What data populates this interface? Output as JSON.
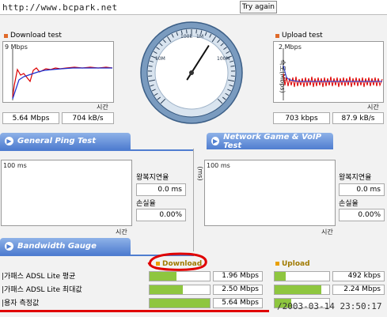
{
  "browser": {
    "url_text": "http://www.bcpark.net",
    "try_again_label": "Try again"
  },
  "download_test": {
    "title": "Download test",
    "max_label": "9 Mbps",
    "time_label": "시간",
    "speed_mbps": "5.64 Mbps",
    "speed_kbs": "704 kB/s"
  },
  "upload_test": {
    "title": "Upload test",
    "max_label": "2 Mbps",
    "y_axis_label": "속도(Mbps)",
    "time_label": "시간",
    "speed_kbps": "703 kbps",
    "speed_kbs": "87.9 kB/s"
  },
  "gauge": {
    "ticks": [
      "100k",
      "1M",
      "10M",
      "100M"
    ],
    "needle_level": 0.62
  },
  "general_ping": {
    "tab_label": "General Ping Test",
    "max_label": "100 ms",
    "time_label": "시간",
    "rtt_label": "왕복지연율",
    "rtt_value": "0.0 ms",
    "loss_label": "손실율",
    "loss_value": "0.00%"
  },
  "network_game": {
    "tab_label": "Network Game & VoIP Test",
    "max_label": "100 ms",
    "y_axis_label": "(ms)",
    "time_label": "시간",
    "rtt_label": "왕복지연율",
    "rtt_value": "0.0 ms",
    "loss_label": "손실율",
    "loss_value": "0.00%"
  },
  "bandwidth": {
    "tab_label": "Bandwidth Gauge",
    "download_header": "Download",
    "upload_header": "Upload",
    "rows": [
      {
        "label": "|가패스 ADSL Lite 평균",
        "dl_value": "1.96 Mbps",
        "dl_fill": 0.45,
        "ul_value": "492 kbps",
        "ul_fill": 0.2
      },
      {
        "label": "|가패스 ADSL Lite 최대값",
        "dl_value": "2.50 Mbps",
        "dl_fill": 0.55,
        "ul_value": "2.24 Mbps",
        "ul_fill": 0.85
      },
      {
        "label": "|용자 측정값",
        "dl_value": "5.64 Mbps",
        "dl_fill": 1.0,
        "ul_value": "703 kbps",
        "ul_fill": 0.3
      }
    ]
  },
  "watermark": "/2003-03-14 23:50:17",
  "colors": {
    "accent_tab": "#4f7dd0",
    "bar_fill": "#8ec63f",
    "annotation_red": "#e00000"
  }
}
